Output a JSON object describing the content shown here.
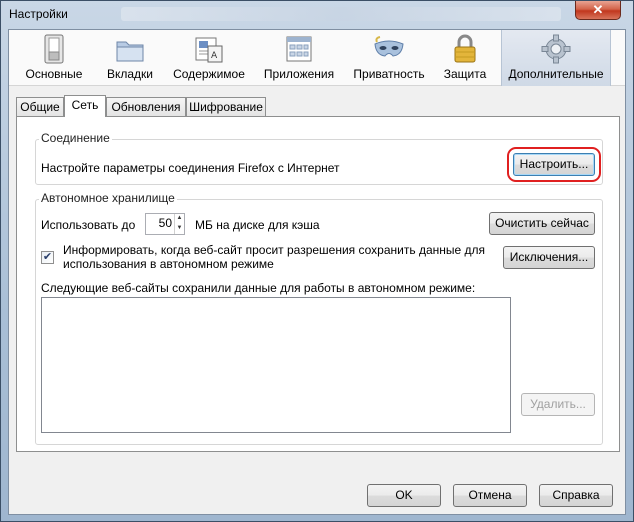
{
  "window": {
    "title": "Настройки",
    "close_glyph": "✕"
  },
  "toolbar": {
    "items": [
      {
        "label": "Основные",
        "icon": "switch-icon"
      },
      {
        "label": "Вкладки",
        "icon": "folder-tabs-icon"
      },
      {
        "label": "Содержимое",
        "icon": "document-content-icon"
      },
      {
        "label": "Приложения",
        "icon": "applications-icon"
      },
      {
        "label": "Приватность",
        "icon": "mask-icon"
      },
      {
        "label": "Защита",
        "icon": "lock-icon"
      },
      {
        "label": "Дополнительные",
        "icon": "gear-icon",
        "selected": true
      }
    ]
  },
  "subtabs": [
    {
      "label": "Общие"
    },
    {
      "label": "Сеть",
      "active": true
    },
    {
      "label": "Обновления"
    },
    {
      "label": "Шифрование"
    }
  ],
  "connection": {
    "group_label": "Соединение",
    "description": "Настройте параметры соединения Firefox с Интернет",
    "settings_button": "Настроить..."
  },
  "offline": {
    "group_label": "Автономное хранилище",
    "use_up_to_label": "Использовать до",
    "cache_value": "50",
    "cache_suffix": "МБ на диске для кэша",
    "clear_now_button": "Очистить сейчас",
    "notify_checked": true,
    "notify_line1": "Информировать, когда веб-сайт просит разрешения сохранить данные для",
    "notify_line2": "использования в автономном режиме",
    "exceptions_button": "Исключения...",
    "sites_label": "Следующие веб-сайты сохранили данные для работы в автономном режиме:",
    "remove_button": "Удалить..."
  },
  "footer": {
    "ok": "OK",
    "cancel": "Отмена",
    "help": "Справка"
  },
  "colors": {
    "highlight_ring": "#e02020",
    "selected_tab_bg": "#cfd9e6"
  }
}
